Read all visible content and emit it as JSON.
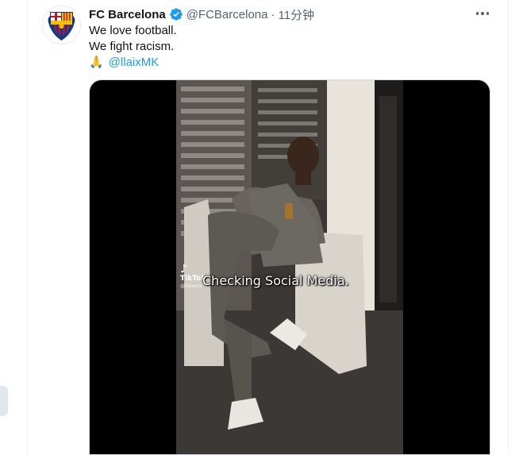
{
  "tweet": {
    "display_name": "FC Barcelona",
    "handle": "@FCBarcelona",
    "separator": "·",
    "time": "11分钟",
    "lines": [
      "We love football.",
      "We fight racism."
    ],
    "emoji": "🙏",
    "mention": "@llaixMK",
    "avatar_text": "FCB",
    "verified_icon": "verified-badge-icon",
    "more_icon": "more-options-icon",
    "accent_color": "#1d9bf0"
  },
  "media": {
    "watermark_brand": "TikTok",
    "watermark_user": "@llaixmk",
    "caption": "Checking Social Media."
  }
}
